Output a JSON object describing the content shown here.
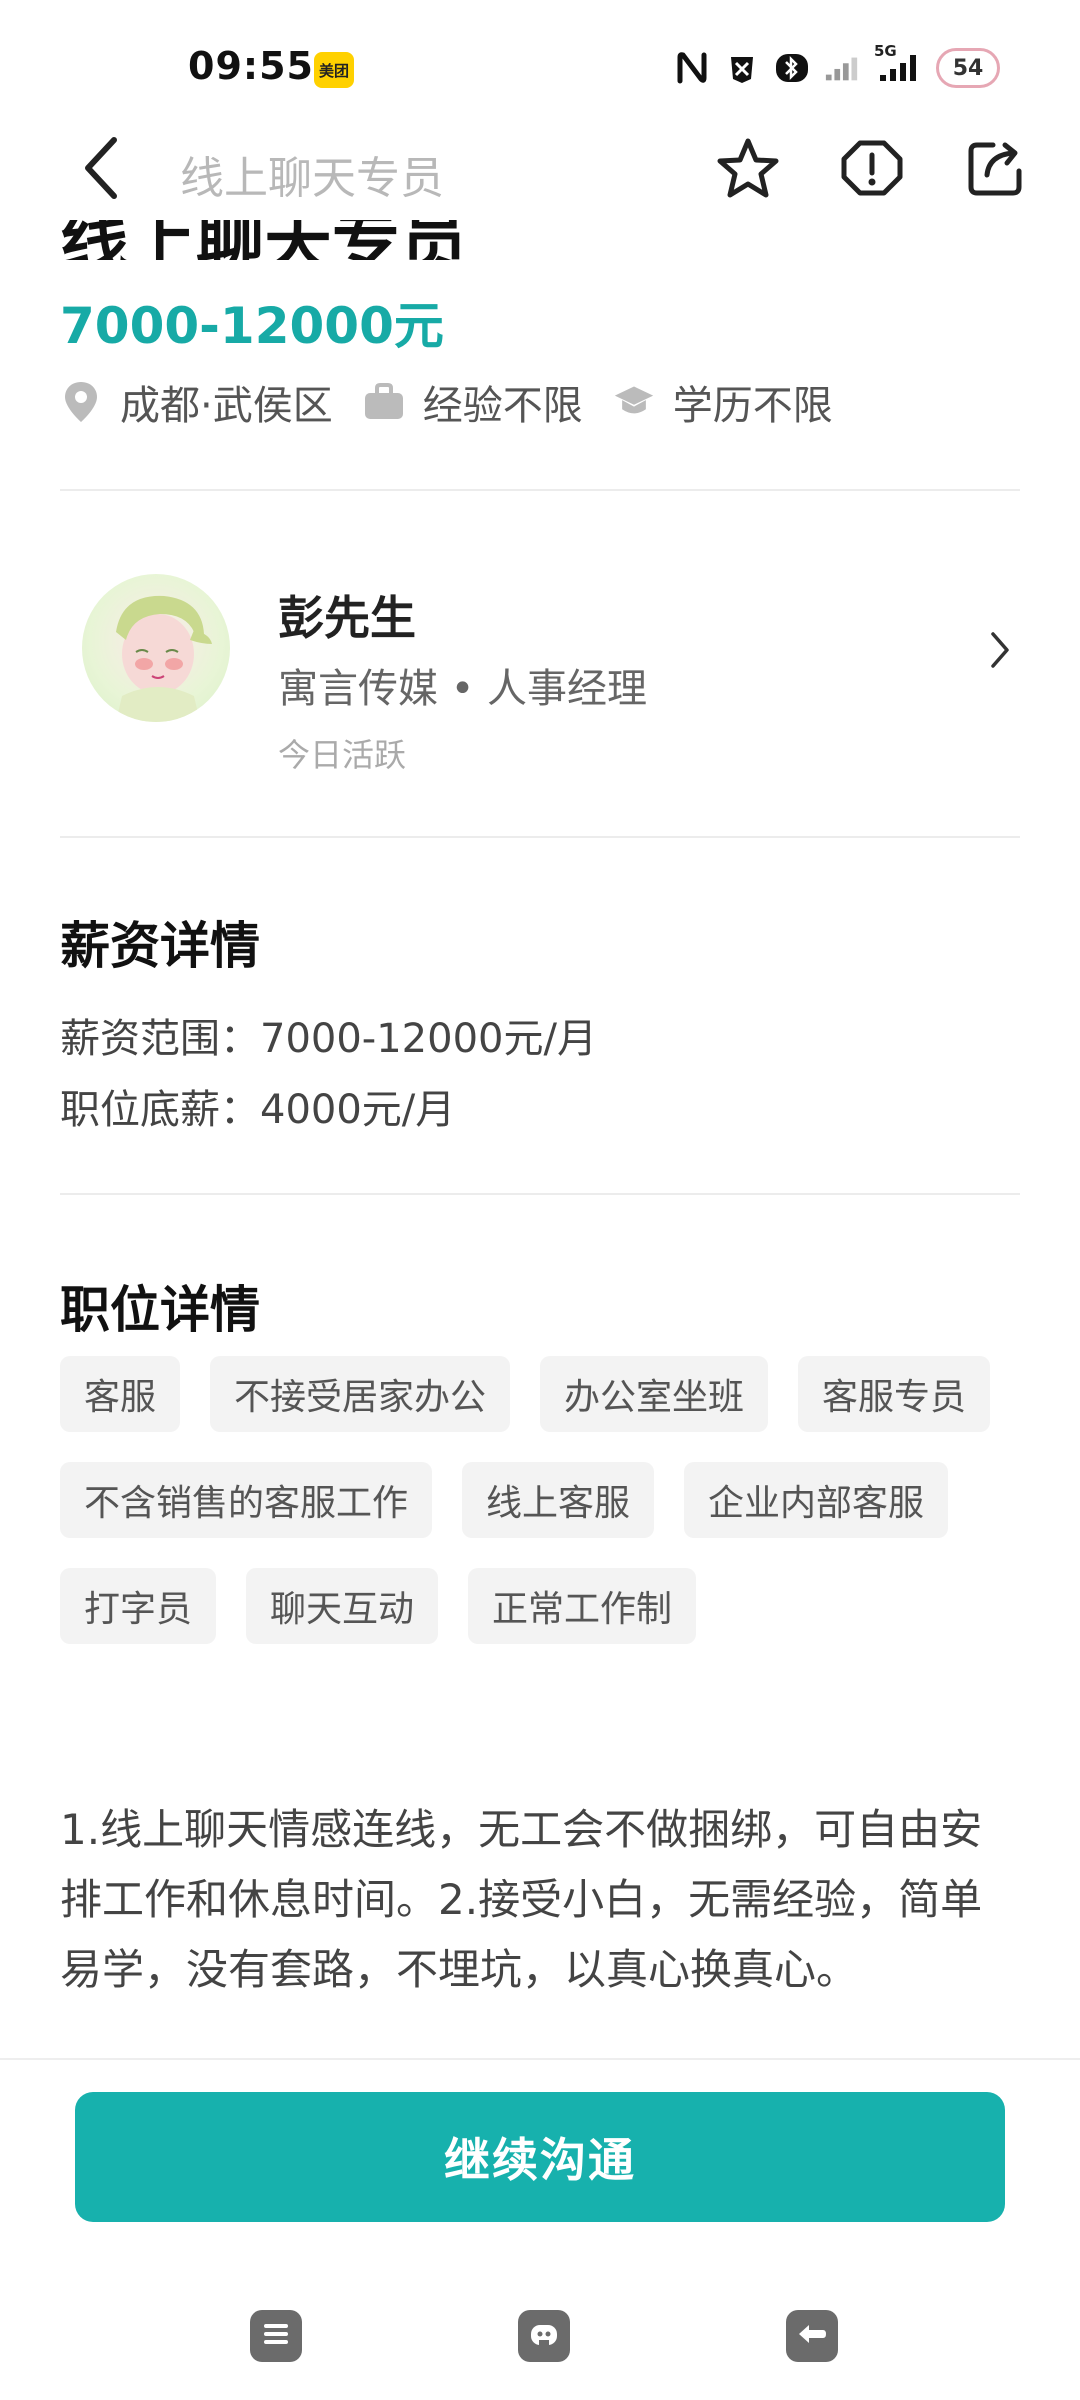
{
  "status_bar": {
    "time": "09:55",
    "app_badge": "美团",
    "network_label": "5G",
    "battery": "54"
  },
  "nav": {
    "title": "线上聊天专员"
  },
  "job": {
    "title": "线上聊天专员",
    "salary": "7000-12000元",
    "location": "成都·武侯区",
    "experience": "经验不限",
    "education": "学历不限"
  },
  "recruiter": {
    "name": "彭先生",
    "company_role": "寓言传媒 • 人事经理",
    "activity": "今日活跃"
  },
  "salary_details": {
    "title": "薪资详情",
    "range": "薪资范围：7000-12000元/月",
    "base": "职位底薪：4000元/月"
  },
  "job_details": {
    "title": "职位详情",
    "tags": [
      "客服",
      "不接受居家办公",
      "办公室坐班",
      "客服专员",
      "不含销售的客服工作",
      "线上客服",
      "企业内部客服",
      "打字员",
      "聊天互动",
      "正常工作制"
    ],
    "description": "1.线上聊天情感连线，无工会不做捆绑，可自由安排工作和休息时间。2.接受小白，无需经验，简单易学，没有套路，不埋坑，以真心换真心。"
  },
  "actions": {
    "continue": "继续沟通"
  },
  "colors": {
    "accent": "#17b1ad",
    "salary": "#17aaa6"
  },
  "icons": {
    "back": "chevron-left-icon",
    "favorite": "star-icon",
    "report": "warning-icon",
    "share": "share-icon",
    "location": "map-pin-icon",
    "experience": "briefcase-icon",
    "education": "graduation-cap-icon"
  }
}
